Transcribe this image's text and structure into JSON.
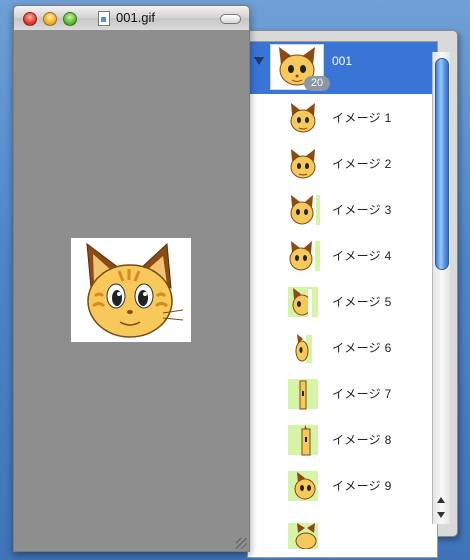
{
  "window": {
    "title": "001.gif",
    "buttons": [
      "close",
      "minimize",
      "zoom"
    ],
    "document_icon": "gif-document-icon"
  },
  "drawer": {
    "parent": {
      "label": "001",
      "count": "20",
      "expanded": true
    },
    "frames": [
      {
        "label": "イメージ 1",
        "variant": "face"
      },
      {
        "label": "イメージ 2",
        "variant": "face"
      },
      {
        "label": "イメージ 3",
        "variant": "face-slice"
      },
      {
        "label": "イメージ 4",
        "variant": "face-slice"
      },
      {
        "label": "イメージ 5",
        "variant": "green-slice"
      },
      {
        "label": "イメージ 6",
        "variant": "thin-slice"
      },
      {
        "label": "イメージ 7",
        "variant": "green-thin"
      },
      {
        "label": "イメージ 8",
        "variant": "green-thin"
      },
      {
        "label": "イメージ 9",
        "variant": "green-slice"
      }
    ],
    "partial_frame_variant": "green-slice"
  },
  "colors": {
    "selection": "#3875d7",
    "preview_bg": "#8e8e8e",
    "cat_fur": "#f7c85a",
    "cat_ear": "#8a4b14",
    "frame_green": "#d5f4a8"
  }
}
